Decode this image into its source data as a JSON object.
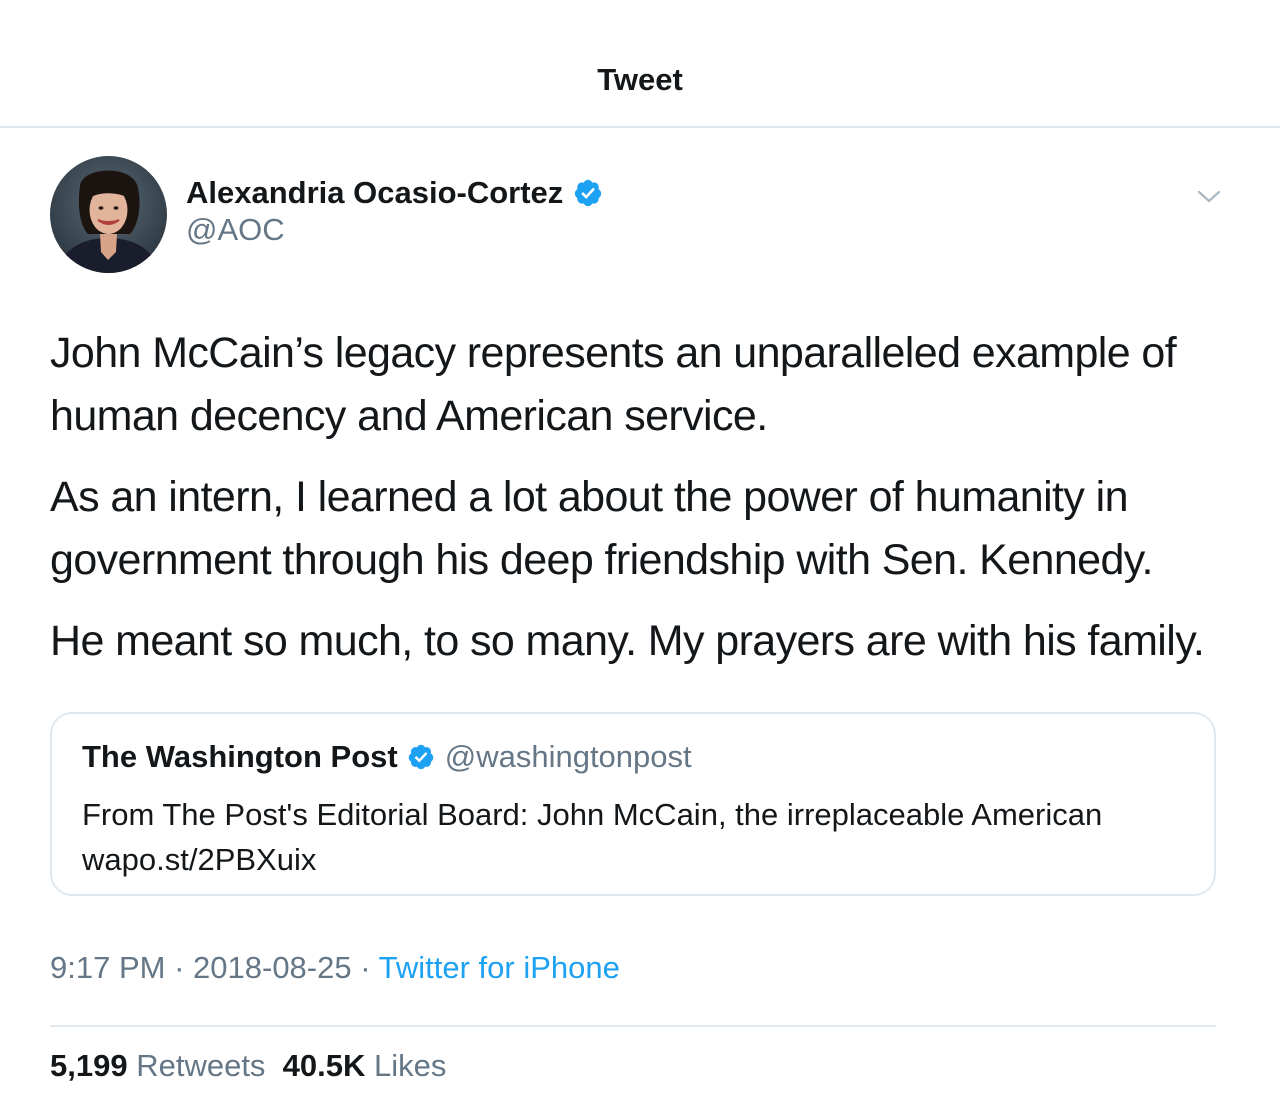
{
  "header": {
    "title": "Tweet"
  },
  "author": {
    "name": "Alexandria Ocasio-Cortez",
    "handle": "@AOC",
    "avatar_icon": "profile-photo",
    "verified_icon": "verified-badge-icon"
  },
  "menu": {
    "icon": "chevron-down-icon"
  },
  "tweet": {
    "paragraphs": [
      "John McCain’s legacy represents an unparalleled example of human decency and American service.",
      "As an intern, I learned a lot about the power of humanity in government through his deep friendship with Sen. Kennedy.",
      "He meant so much, to so many. My prayers are with his family."
    ]
  },
  "quote": {
    "name": "The Washington Post",
    "handle": "@washingtonpost",
    "text": "From The Post's Editorial Board: John McCain, the irreplaceable American",
    "link": "wapo.st/2PBXuix"
  },
  "meta": {
    "time": "9:17 PM",
    "date": "2018-08-25",
    "separator": "·",
    "source": "Twitter for iPhone"
  },
  "stats": {
    "retweets_count": "5,199",
    "retweets_label": "Retweets",
    "likes_count": "40.5K",
    "likes_label": "Likes"
  },
  "colors": {
    "text": "#14171a",
    "secondary": "#657786",
    "accent": "#1da1f2",
    "border": "#e1e8ed"
  }
}
